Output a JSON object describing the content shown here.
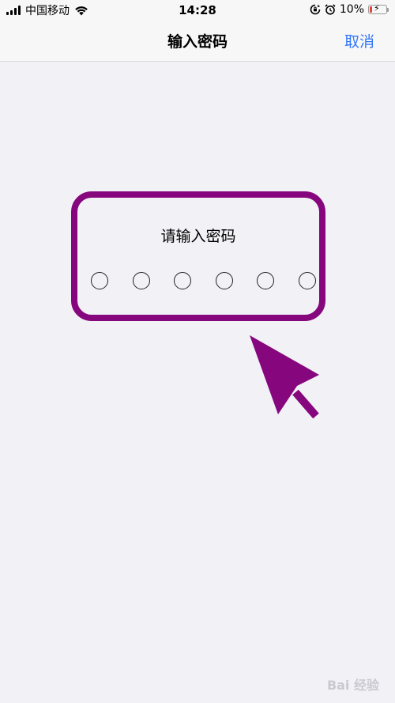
{
  "status_bar": {
    "carrier": "中国移动",
    "time": "14:28",
    "battery_percent": "10%",
    "icons": [
      "signal-icon",
      "wifi-icon",
      "rotation-lock-icon",
      "alarm-icon",
      "battery-icon"
    ]
  },
  "nav": {
    "title": "输入密码",
    "cancel_label": "取消"
  },
  "passcode": {
    "prompt": "请输入密码",
    "digit_count": 6,
    "highlight_color": "#86067d"
  },
  "colors": {
    "accent": "#3478f6",
    "background": "#f2f1f6",
    "annotation": "#86067d"
  },
  "watermark": {
    "text": "Bai 经验"
  }
}
